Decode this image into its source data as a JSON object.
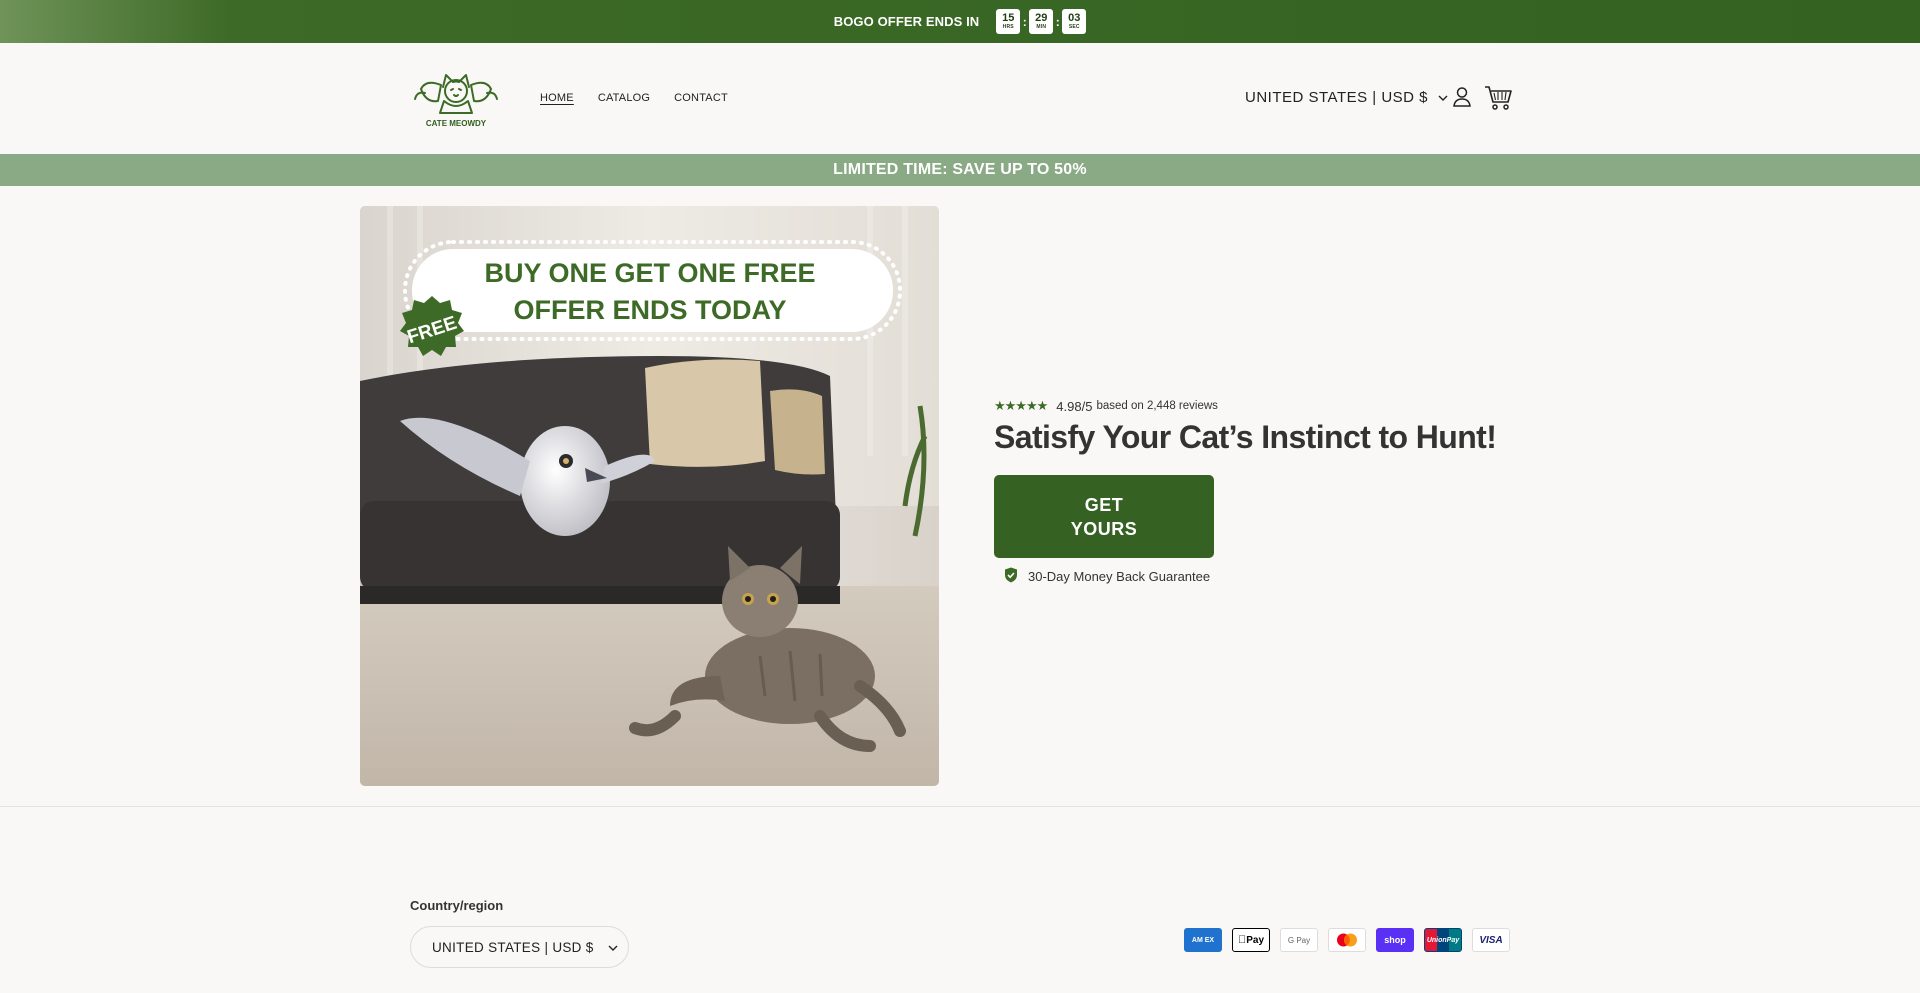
{
  "topbar": {
    "text": "BOGO OFFER ENDS IN",
    "timer": [
      {
        "value": "15",
        "label": "HRS"
      },
      {
        "value": "29",
        "label": "MIN"
      },
      {
        "value": "03",
        "label": "SEC"
      }
    ],
    "separator": ":"
  },
  "header": {
    "logo_text": "CATE MEOWDY",
    "nav": [
      {
        "label": "HOME",
        "active": true
      },
      {
        "label": "CATALOG",
        "active": false
      },
      {
        "label": "CONTACT",
        "active": false
      }
    ],
    "locale": "UNITED STATES | USD $",
    "icons": {
      "account": "account-icon",
      "cart": "cart-icon"
    }
  },
  "sale_banner": {
    "text": "LIMITED TIME: SAVE UP TO 50%"
  },
  "hero": {
    "image": {
      "banner_line1": "BUY ONE GET ONE FREE",
      "banner_line2": "OFFER ENDS TODAY",
      "badge": "FREE"
    },
    "rating": {
      "stars": "★★★★★",
      "score": "4.98/5",
      "note": "based on 2,448 reviews"
    },
    "headline": "Satisfy Your Cat’s Instinct to Hunt!",
    "cta_label": "GET YOURS",
    "guarantee": "30-Day Money Back Guarantee"
  },
  "footer": {
    "country_label": "Country/region",
    "country_value": "UNITED STATES | USD $",
    "payments": [
      {
        "name": "American Express",
        "text": "AM EX",
        "bg": "#1f72cd",
        "fg": "#ffffff"
      },
      {
        "name": "Apple Pay",
        "text": "Pay",
        "bg": "#ffffff",
        "fg": "#000000"
      },
      {
        "name": "Google Pay",
        "text": "G Pay",
        "bg": "#ffffff",
        "fg": "#5f6368"
      },
      {
        "name": "Mastercard",
        "text": "",
        "bg": "#ffffff",
        "fg": "#000000"
      },
      {
        "name": "Shop Pay",
        "text": "shop",
        "bg": "#5a31f4",
        "fg": "#ffffff"
      },
      {
        "name": "UnionPay",
        "text": "UnionPay",
        "bg": "#e21836",
        "fg": "#ffffff"
      },
      {
        "name": "Visa",
        "text": "VISA",
        "bg": "#ffffff",
        "fg": "#1a1f71"
      }
    ]
  },
  "colors": {
    "brand_green": "#356223",
    "sale_green": "#8aa985",
    "background": "#faf8f6"
  }
}
